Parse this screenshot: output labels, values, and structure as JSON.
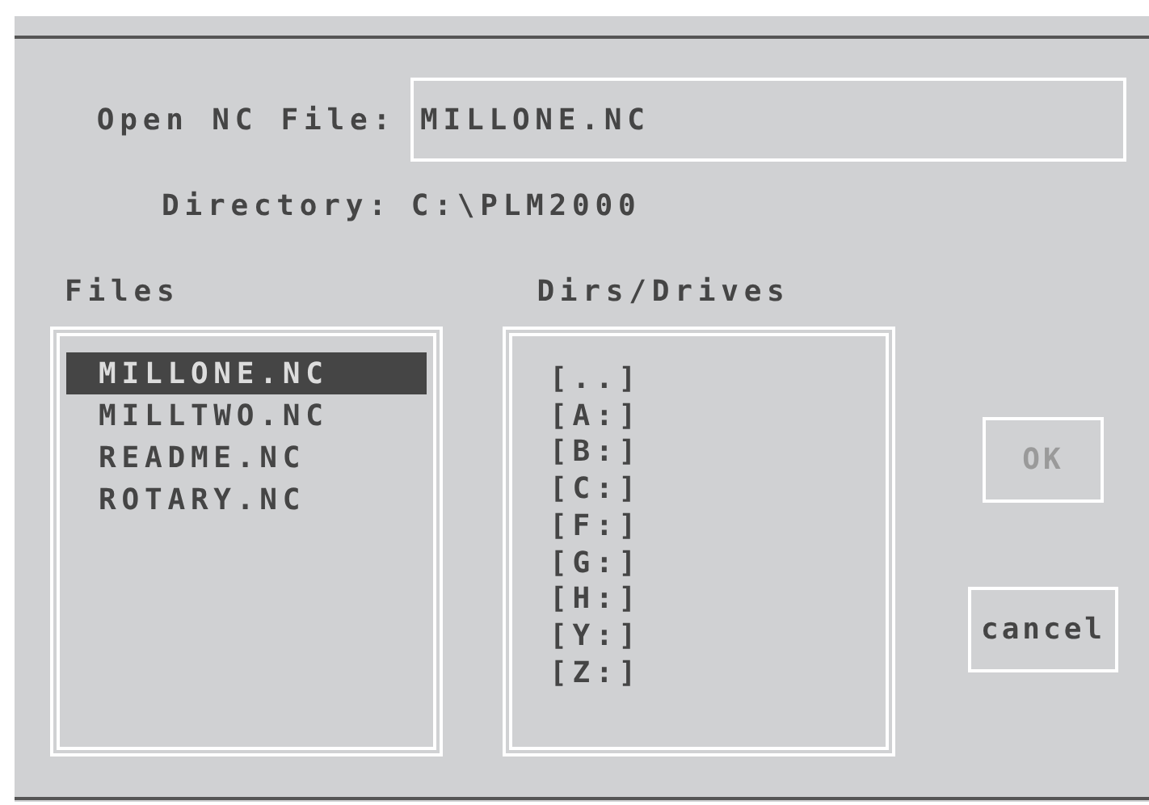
{
  "dialog": {
    "file_name_label": "Open NC File:",
    "file_name": "MILLONE.NC",
    "directory_label": "Directory:",
    "directory": "C:\\PLM2000",
    "files": {
      "label": "Files",
      "items": [
        {
          "name": "MILLONE.NC",
          "selected": true
        },
        {
          "name": "MILLTWO.NC",
          "selected": false
        },
        {
          "name": "README.NC",
          "selected": false
        },
        {
          "name": "ROTARY.NC",
          "selected": false
        }
      ]
    },
    "dirs": {
      "label": "Dirs/Drives",
      "items": [
        {
          "name": "[..]",
          "selected": false
        },
        {
          "name": "[A:]",
          "selected": false
        },
        {
          "name": "[B:]",
          "selected": false
        },
        {
          "name": "[C:]",
          "selected": false
        },
        {
          "name": "[F:]",
          "selected": false
        },
        {
          "name": "[G:]",
          "selected": false
        },
        {
          "name": "[H:]",
          "selected": false
        },
        {
          "name": "[Y:]",
          "selected": false
        },
        {
          "name": "[Z:]",
          "selected": false
        }
      ]
    },
    "buttons": [
      {
        "label": "OK",
        "disabled": true
      },
      {
        "label": "cancel",
        "disabled": false
      }
    ]
  }
}
